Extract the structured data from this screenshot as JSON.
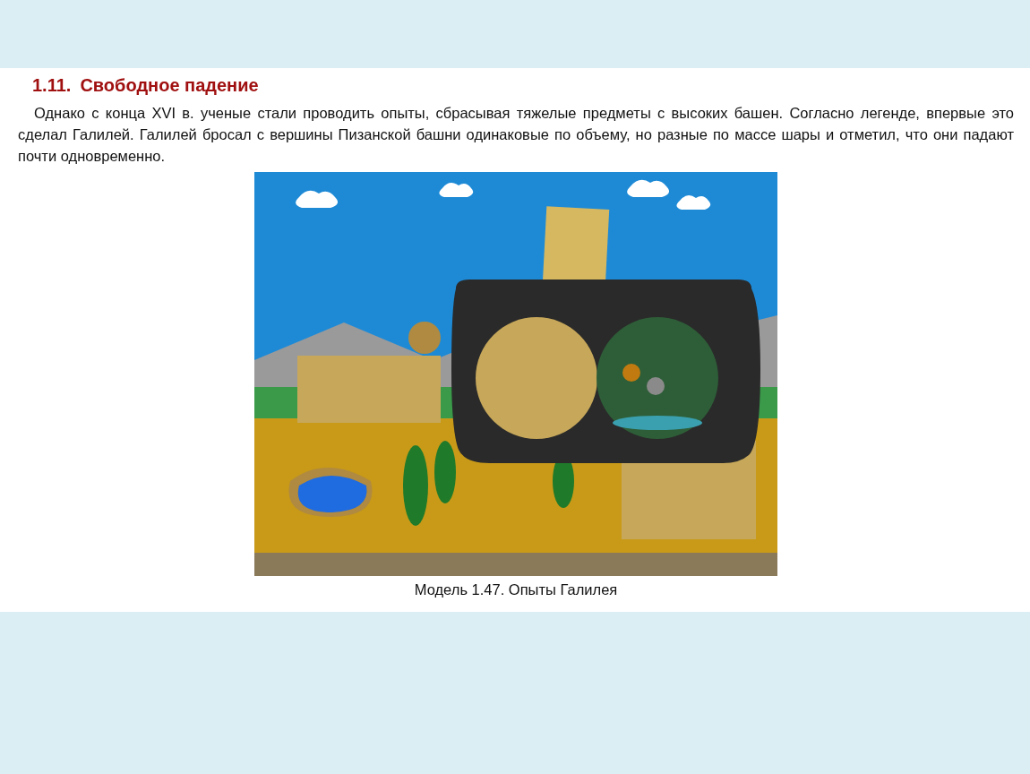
{
  "section": {
    "number": "1.11.",
    "title": "Свободное падение"
  },
  "paragraph": "Однако с конца XVI в. ученые стали проводить опыты, сбрасывая тяжелые предметы с высоких башен. Согласно легенде, впервые это сделал Галилей. Галилей бросал с вершины Пизанской башни одинаковые по объему, но разные по массе шары и отметил, что они падают почти одновременно.",
  "figure": {
    "caption": "Модель 1.47. Опыты Галилея"
  }
}
